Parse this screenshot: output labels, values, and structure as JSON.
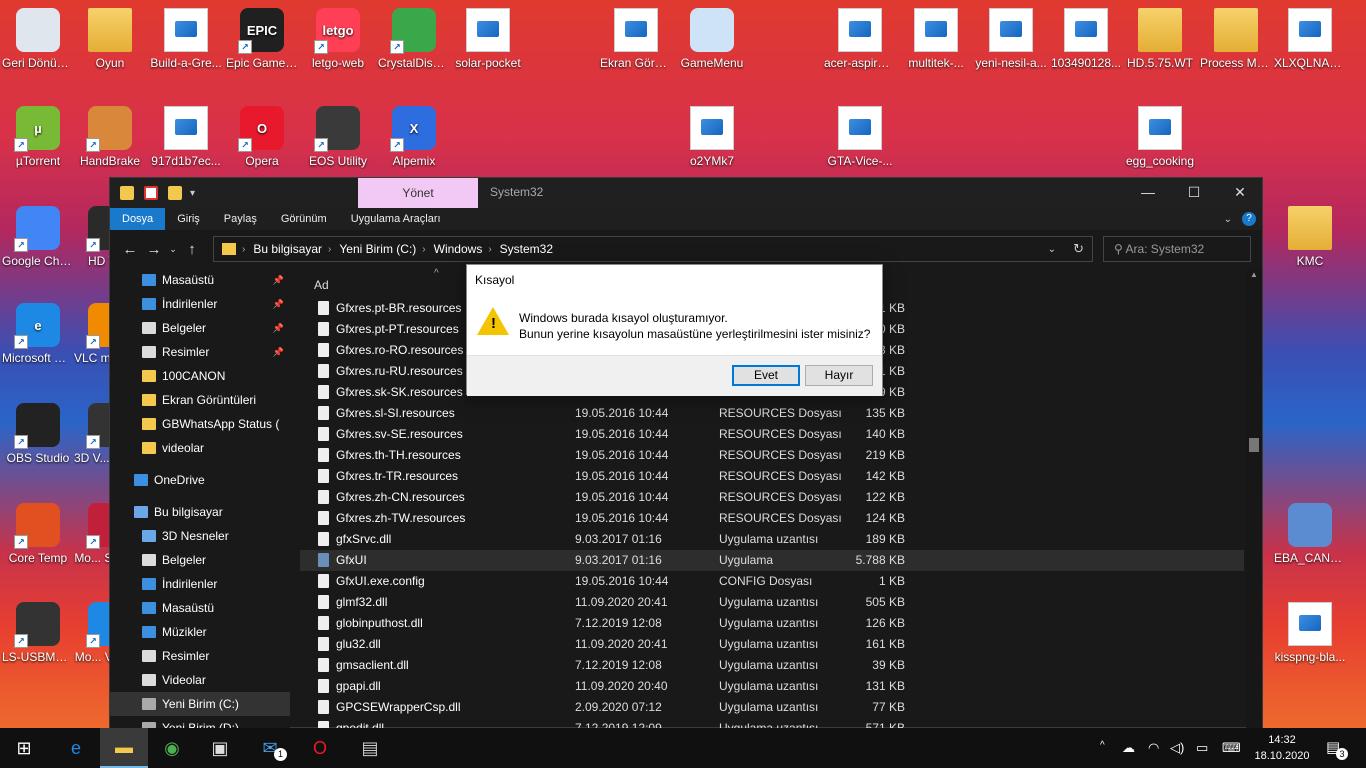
{
  "desktop_icons": [
    {
      "label": "Geri Dönüşü...",
      "icon": "recycle-bin-icon",
      "color": "#dfe6ee",
      "shortcut": false
    },
    {
      "label": "Oyun",
      "icon": "folder-icon",
      "type": "folder"
    },
    {
      "label": "Build-a-Gre...",
      "icon": "image-file-icon",
      "type": "file"
    },
    {
      "label": "Epic Games Launcher",
      "icon": "epic-games-icon",
      "color": "#202020",
      "glyph": "EPIC",
      "shortcut": true
    },
    {
      "label": "letgo-web",
      "icon": "letgo-icon",
      "color": "#ff3f55",
      "glyph": "letgo",
      "shortcut": true
    },
    {
      "label": "CrystalDisk... 7",
      "icon": "crystaldisk-icon",
      "color": "#3aa84a",
      "shortcut": true
    },
    {
      "label": "solar-pocket",
      "icon": "image-file-icon",
      "type": "file"
    },
    {
      "label": "Ekran Görüntü...",
      "icon": "image-file-icon",
      "type": "file"
    },
    {
      "label": "GameMenu",
      "icon": "notepad-icon",
      "color": "#cfe3f7",
      "shortcut": false
    },
    {
      "label": "acer-aspire-...",
      "icon": "image-file-icon",
      "type": "file"
    },
    {
      "label": "multitek-...",
      "icon": "image-file-icon",
      "type": "file"
    },
    {
      "label": "yeni-nesil-a...",
      "icon": "image-file-icon",
      "type": "file"
    },
    {
      "label": "103490128...",
      "icon": "image-file-icon",
      "type": "file"
    },
    {
      "label": "HD.5.75.WT",
      "icon": "folder-icon",
      "type": "folder"
    },
    {
      "label": "Process Monitor",
      "icon": "folder-icon",
      "type": "folder"
    },
    {
      "label": "XLXQLNAK...",
      "icon": "image-file-icon",
      "type": "file"
    },
    {
      "label": "µTorrent",
      "icon": "utorrent-icon",
      "color": "#78b935",
      "glyph": "µ",
      "shortcut": true
    },
    {
      "label": "HandBrake",
      "icon": "handbrake-icon",
      "color": "#d9873a",
      "shortcut": true
    },
    {
      "label": "917d1b7ec...",
      "icon": "image-file-icon",
      "type": "file"
    },
    {
      "label": "Opera",
      "icon": "opera-icon",
      "color": "#e8192c",
      "glyph": "O",
      "shortcut": true
    },
    {
      "label": "EOS Utility",
      "icon": "camera-icon",
      "color": "#3a3a3a",
      "shortcut": true
    },
    {
      "label": "Alpemix",
      "icon": "alpemix-icon",
      "color": "#2d6de0",
      "glyph": "X",
      "shortcut": true
    },
    {
      "label": "o2YMk7",
      "icon": "image-file-icon",
      "type": "file"
    },
    {
      "label": "GTA-Vice-...",
      "icon": "image-file-icon",
      "type": "file"
    },
    {
      "label": "egg_cooking",
      "icon": "image-file-icon",
      "type": "file"
    },
    {
      "label": "Google Chrome",
      "icon": "chrome-icon",
      "color": "#4285f4",
      "shortcut": true
    },
    {
      "label": "HD Tu...",
      "icon": "hdtune-icon",
      "color": "#2a2a2a",
      "shortcut": true
    },
    {
      "label": "KMC",
      "icon": "folder-icon",
      "type": "folder"
    },
    {
      "label": "Microsoft Edge",
      "icon": "edge-icon",
      "color": "#1e88e5",
      "glyph": "e",
      "shortcut": true
    },
    {
      "label": "VLC m... pla...",
      "icon": "vlc-icon",
      "color": "#f08a00",
      "shortcut": true
    },
    {
      "label": "OBS Studio",
      "icon": "obs-icon",
      "color": "#222",
      "shortcut": true
    },
    {
      "label": "3D V... Fotoğ...",
      "icon": "viewer-icon",
      "color": "#333",
      "shortcut": true
    },
    {
      "label": "Core Temp",
      "icon": "coretemp-icon",
      "color": "#e05020",
      "shortcut": true
    },
    {
      "label": "Mo... Scree...",
      "icon": "screen-icon",
      "color": "#c0203a",
      "shortcut": true
    },
    {
      "label": "EBA_CANL...",
      "icon": "installer-icon",
      "color": "#5b8bd0",
      "shortcut": false
    },
    {
      "label": "LS-USBMX1 2 3 Steerin...",
      "icon": "steering-icon",
      "color": "#333",
      "shortcut": true
    },
    {
      "label": "Mo... Video...",
      "icon": "video-icon",
      "color": "#1e88e5",
      "shortcut": true
    },
    {
      "label": "kisspng-bla...",
      "icon": "image-file-icon",
      "type": "file"
    }
  ],
  "explorer": {
    "manage_tab": "Yönet",
    "title": "System32",
    "window_controls": {
      "minimize": "—",
      "maximize": "☐",
      "close": "✕"
    },
    "ribbon_tabs": [
      "Dosya",
      "Giriş",
      "Paylaş",
      "Görünüm",
      "Uygulama Araçları"
    ],
    "breadcrumb": [
      "Bu bilgisayar",
      "Yeni Birim (C:)",
      "Windows",
      "System32"
    ],
    "search_placeholder": "Ara: System32",
    "column_header": "Ad",
    "nav_items": [
      {
        "label": "Masaüstü",
        "icon": "desktop-icon",
        "color": "#3d8fe0",
        "pinned": true,
        "indent": 1
      },
      {
        "label": "İndirilenler",
        "icon": "download-icon",
        "color": "#3d8fe0",
        "pinned": true,
        "indent": 1
      },
      {
        "label": "Belgeler",
        "icon": "documents-icon",
        "color": "#dcdcdc",
        "pinned": true,
        "indent": 1
      },
      {
        "label": "Resimler",
        "icon": "pictures-icon",
        "color": "#dcdcdc",
        "pinned": true,
        "indent": 1
      },
      {
        "label": "100CANON",
        "icon": "folder-icon",
        "color": "#f2c94c",
        "indent": 1
      },
      {
        "label": "Ekran Görüntüleri",
        "icon": "folder-icon",
        "color": "#f2c94c",
        "indent": 1
      },
      {
        "label": "GBWhatsApp Status (",
        "icon": "folder-icon",
        "color": "#f2c94c",
        "indent": 1
      },
      {
        "label": "videolar",
        "icon": "folder-icon",
        "color": "#f2c94c",
        "indent": 1
      },
      {
        "label": "OneDrive",
        "icon": "onedrive-icon",
        "color": "#3d8fe0",
        "indent": 0,
        "gap": true
      },
      {
        "label": "Bu bilgisayar",
        "icon": "computer-icon",
        "color": "#6aa7e8",
        "indent": 0,
        "gap": true
      },
      {
        "label": "3D Nesneler",
        "icon": "3d-objects-icon",
        "color": "#6aa7e8",
        "indent": 1
      },
      {
        "label": "Belgeler",
        "icon": "documents-icon",
        "color": "#dcdcdc",
        "indent": 1
      },
      {
        "label": "İndirilenler",
        "icon": "download-icon",
        "color": "#3d8fe0",
        "indent": 1
      },
      {
        "label": "Masaüstü",
        "icon": "desktop-icon",
        "color": "#3d8fe0",
        "indent": 1
      },
      {
        "label": "Müzikler",
        "icon": "music-icon",
        "color": "#3d8fe0",
        "indent": 1
      },
      {
        "label": "Resimler",
        "icon": "pictures-icon",
        "color": "#dcdcdc",
        "indent": 1
      },
      {
        "label": "Videolar",
        "icon": "videos-icon",
        "color": "#dcdcdc",
        "indent": 1
      },
      {
        "label": "Yeni Birim (C:)",
        "icon": "drive-icon",
        "color": "#aaaaaa",
        "indent": 1,
        "selected": true
      },
      {
        "label": "Yeni Birim (D:)",
        "icon": "drive-icon",
        "color": "#aaaaaa",
        "indent": 1
      }
    ],
    "files": [
      {
        "name": "Gfxres.pt-BR.resources",
        "date": "",
        "type": "",
        "size": "1 KB"
      },
      {
        "name": "Gfxres.pt-PT.resources",
        "date": "",
        "type": "",
        "size": "0 KB"
      },
      {
        "name": "Gfxres.ro-RO.resources",
        "date": "",
        "type": "",
        "size": "3 KB"
      },
      {
        "name": "Gfxres.ru-RU.resources",
        "date": "",
        "type": "",
        "size": "1 KB"
      },
      {
        "name": "Gfxres.sk-SK.resources",
        "date": "",
        "type": "",
        "size": "9 KB"
      },
      {
        "name": "Gfxres.sl-SI.resources",
        "date": "19.05.2016 10:44",
        "type": "RESOURCES Dosyası",
        "size": "135 KB"
      },
      {
        "name": "Gfxres.sv-SE.resources",
        "date": "19.05.2016 10:44",
        "type": "RESOURCES Dosyası",
        "size": "140 KB"
      },
      {
        "name": "Gfxres.th-TH.resources",
        "date": "19.05.2016 10:44",
        "type": "RESOURCES Dosyası",
        "size": "219 KB"
      },
      {
        "name": "Gfxres.tr-TR.resources",
        "date": "19.05.2016 10:44",
        "type": "RESOURCES Dosyası",
        "size": "142 KB"
      },
      {
        "name": "Gfxres.zh-CN.resources",
        "date": "19.05.2016 10:44",
        "type": "RESOURCES Dosyası",
        "size": "122 KB"
      },
      {
        "name": "Gfxres.zh-TW.resources",
        "date": "19.05.2016 10:44",
        "type": "RESOURCES Dosyası",
        "size": "124 KB"
      },
      {
        "name": "gfxSrvc.dll",
        "date": "9.03.2017 01:16",
        "type": "Uygulama uzantısı",
        "size": "189 KB"
      },
      {
        "name": "GfxUI",
        "date": "9.03.2017 01:16",
        "type": "Uygulama",
        "size": "5.788 KB",
        "kind": "exe",
        "highlight": true
      },
      {
        "name": "GfxUI.exe.config",
        "date": "19.05.2016 10:44",
        "type": "CONFIG Dosyası",
        "size": "1 KB"
      },
      {
        "name": "glmf32.dll",
        "date": "11.09.2020 20:41",
        "type": "Uygulama uzantısı",
        "size": "505 KB"
      },
      {
        "name": "globinputhost.dll",
        "date": "7.12.2019 12:08",
        "type": "Uygulama uzantısı",
        "size": "126 KB"
      },
      {
        "name": "glu32.dll",
        "date": "11.09.2020 20:41",
        "type": "Uygulama uzantısı",
        "size": "161 KB"
      },
      {
        "name": "gmsaclient.dll",
        "date": "7.12.2019 12:08",
        "type": "Uygulama uzantısı",
        "size": "39 KB"
      },
      {
        "name": "gpapi.dll",
        "date": "11.09.2020 20:40",
        "type": "Uygulama uzantısı",
        "size": "131 KB"
      },
      {
        "name": "GPCSEWrapperCsp.dll",
        "date": "2.09.2020 07:12",
        "type": "Uygulama uzantısı",
        "size": "77 KB"
      },
      {
        "name": "gpedit.dll",
        "date": "7.12.2019 12:09",
        "type": "Uygulama uzantısı",
        "size": "571 KB"
      }
    ]
  },
  "dialog": {
    "title": "Kısayol",
    "line1": "Windows burada kısayol oluşturamıyor.",
    "line2": "Bunun yerine kısayolun masaüstüne yerleştirilmesini ister misiniz?",
    "yes": "Evet",
    "no": "Hayır",
    "warning_color": "#f5c400"
  },
  "taskbar": {
    "apps": [
      {
        "name": "start-button",
        "glyph": "⊞",
        "color": "#ffffff"
      },
      {
        "name": "edge-taskbar-icon",
        "glyph": "e",
        "color": "#1e88e5"
      },
      {
        "name": "explorer-taskbar-icon",
        "glyph": "▬",
        "color": "#f2c94c",
        "active": true
      },
      {
        "name": "chrome-taskbar-icon",
        "glyph": "◉",
        "color": "#4caf50"
      },
      {
        "name": "store-taskbar-icon",
        "glyph": "▣",
        "color": "#dddddd"
      },
      {
        "name": "mail-taskbar-icon",
        "glyph": "✉",
        "color": "#4a9fe8"
      },
      {
        "name": "opera-taskbar-icon",
        "glyph": "O",
        "color": "#e8192c"
      },
      {
        "name": "app-taskbar-icon",
        "glyph": "▤",
        "color": "#cccccc"
      }
    ],
    "mail_badge": "1",
    "time": "14:32",
    "date": "18.10.2020",
    "notification_count": "3"
  }
}
